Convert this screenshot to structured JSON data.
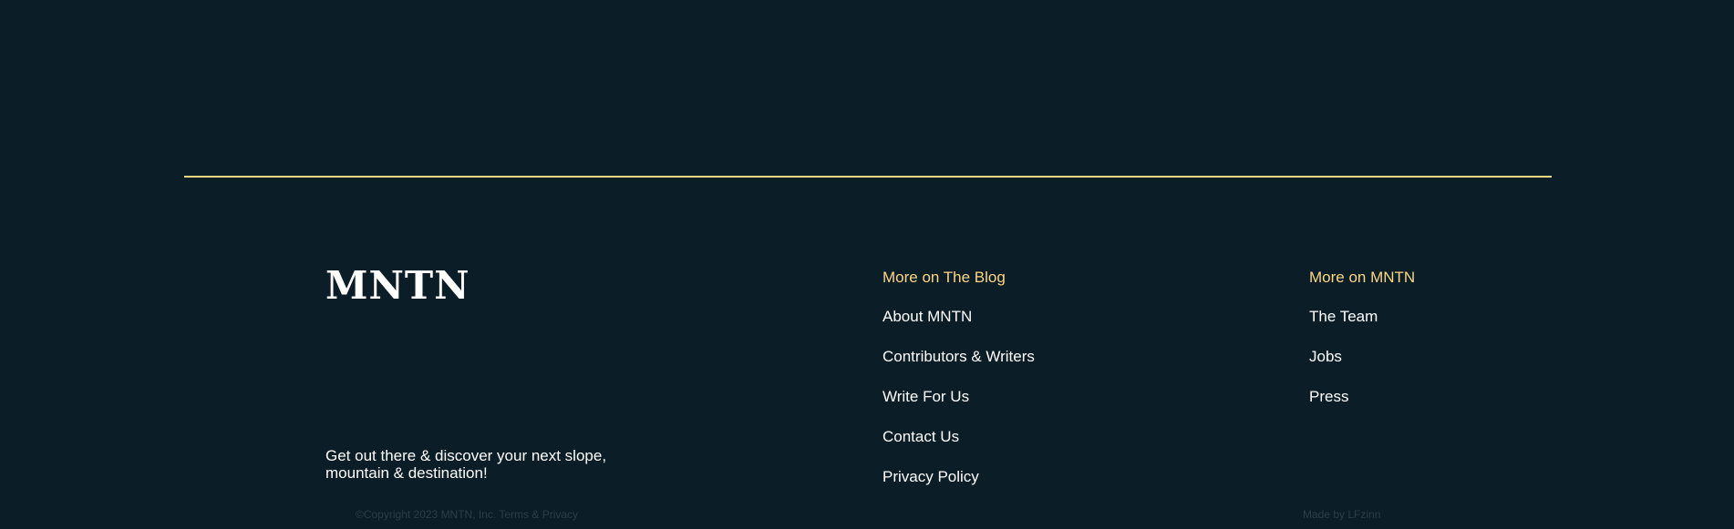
{
  "brand": {
    "logo_text": "MNTN"
  },
  "tagline": "Get out there & discover your next slope, mountain & destination!",
  "columns": [
    {
      "heading": "More on The Blog",
      "links": [
        "About MNTN",
        "Contributors & Writers",
        "Write For Us",
        "Contact Us",
        "Privacy Policy"
      ]
    },
    {
      "heading": "More on MNTN",
      "links": [
        "The Team",
        "Jobs",
        "Press"
      ]
    }
  ],
  "legal": {
    "copyright": "©Copyright 2023 MNTN, Inc.",
    "terms_link": "Terms & Privacy",
    "made_by": "Made by LFzinn"
  },
  "colors": {
    "background": "#0b1d26",
    "accent": "#fbd784",
    "text": "#ffffff",
    "muted": "#2c3d46"
  }
}
